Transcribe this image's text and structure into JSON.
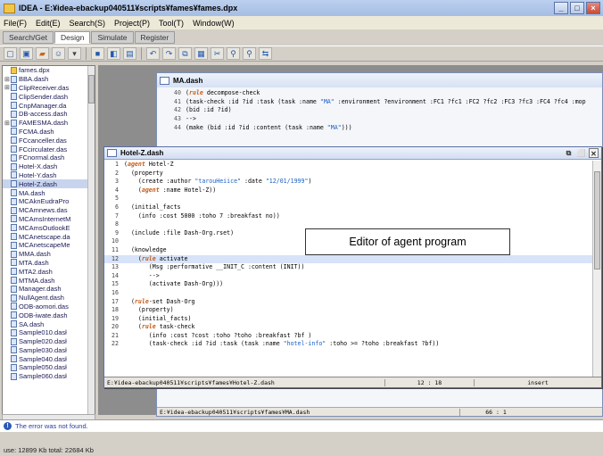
{
  "window": {
    "title": "IDEA - E:¥idea-ebackup040511¥scripts¥fames¥fames.dpx"
  },
  "menu": [
    "File(F)",
    "Edit(E)",
    "Search(S)",
    "Project(P)",
    "Tool(T)",
    "Window(W)"
  ],
  "tabs": [
    "Search/Get",
    "Design",
    "Simulate",
    "Register"
  ],
  "files": [
    {
      "name": "fames.dpx",
      "root": true
    },
    {
      "name": "BBA.dash",
      "plus": true
    },
    {
      "name": "ClipReceiver.das",
      "plus": true
    },
    {
      "name": "ClipSender.dash"
    },
    {
      "name": "CnpManager.da"
    },
    {
      "name": "DB-access.dash"
    },
    {
      "name": "FAMESMA.dash",
      "plus": true
    },
    {
      "name": "FCMA.dash"
    },
    {
      "name": "FCcanceller.das"
    },
    {
      "name": "FCcirculater.das"
    },
    {
      "name": "FCnormal.dash"
    },
    {
      "name": "Hotel-X.dash"
    },
    {
      "name": "Hotel-Y.dash"
    },
    {
      "name": "Hotel-Z.dash",
      "selected": true
    },
    {
      "name": "MA.dash"
    },
    {
      "name": "MCAknEudraPro"
    },
    {
      "name": "MCAmnews.das"
    },
    {
      "name": "MCAmsInternetM"
    },
    {
      "name": "MCAmsOutlookE"
    },
    {
      "name": "MCAnetscape.da"
    },
    {
      "name": "MCAnetscapeMe"
    },
    {
      "name": "MMA.dash"
    },
    {
      "name": "MTA.dash"
    },
    {
      "name": "MTA2.dash"
    },
    {
      "name": "MTMA.dash"
    },
    {
      "name": "Manager.dash"
    },
    {
      "name": "NullAgent.dash"
    },
    {
      "name": "ODB-aomori.das"
    },
    {
      "name": "ODB-iwate.dash"
    },
    {
      "name": "SA.dash"
    },
    {
      "name": "Sample010.dasł"
    },
    {
      "name": "Sample020.dasł"
    },
    {
      "name": "Sample030.dasł"
    },
    {
      "name": "Sample040.dasł"
    },
    {
      "name": "Sample050.dasł"
    },
    {
      "name": "Sample060.dasł"
    }
  ],
  "ma_window": {
    "title": "MA.dash",
    "lines": [
      {
        "n": "40",
        "text": "(rule decompose-check"
      },
      {
        "n": "41",
        "text": "    (task-check :id ?id :task (task :name \"MA\" :environment ?environment :FC1 ?fc1 :FC2 ?fc2 :FC3 ?fc3 :FC4 ?fc4 :mop"
      },
      {
        "n": "42",
        "text": "    (bid :id ?id)"
      },
      {
        "n": "43",
        "text": "    -->"
      },
      {
        "n": "44",
        "text": "    (make (bid :id ?id :content (task :name \"MA\")))"
      }
    ],
    "status_path": "E:¥idea-ebackup040511¥scripts¥fames¥MA.dash",
    "status_pos": "66 : 1"
  },
  "hotel_window": {
    "title": "Hotel-Z.dash",
    "lines": [
      {
        "n": "1",
        "text": "(agent Hotel-Z"
      },
      {
        "n": "2",
        "text": "  (property"
      },
      {
        "n": "3",
        "text": "    (create :author \"tarouHeiice\" :date \"12/01/1999\")"
      },
      {
        "n": "4",
        "text": "    (agent :name Hotel-Z))"
      },
      {
        "n": "5",
        "text": ""
      },
      {
        "n": "6",
        "text": "  (initial_facts"
      },
      {
        "n": "7",
        "text": "    (info :cost 5000 :toho 7 :breakfast no))"
      },
      {
        "n": "8",
        "text": ""
      },
      {
        "n": "9",
        "text": "  (include :file Dash-Org.rset)"
      },
      {
        "n": "10",
        "text": ""
      },
      {
        "n": "11",
        "text": "  (knowledge"
      },
      {
        "n": "12",
        "text": "    (rule activate"
      },
      {
        "n": "13",
        "text": "       (Msg :performative __INIT_C :content (INIT))"
      },
      {
        "n": "14",
        "text": "       -->"
      },
      {
        "n": "15",
        "text": "       (activate Dash-Org)))"
      },
      {
        "n": "16",
        "text": ""
      },
      {
        "n": "17",
        "text": "  (rule-set Dash-Org"
      },
      {
        "n": "18",
        "text": "    (property)"
      },
      {
        "n": "19",
        "text": "    (initial_facts)"
      },
      {
        "n": "20",
        "text": "    (rule task-check"
      },
      {
        "n": "21",
        "text": "       (info :cost ?cost :toho ?toho :breakfast ?bf )"
      },
      {
        "n": "22",
        "text": "       (task-check :id ?id :task (task :name \"hotel-info\" :toho >= ?toho :breakfast ?bf))"
      }
    ],
    "status_path": "E:¥idea-ebackup040511¥scripts¥fames¥Hotel-Z.dash",
    "status_pos": "12 : 18",
    "status_mode": "insert"
  },
  "annotation": "Editor of agent program",
  "message": "The error was not found.",
  "status": "use: 12899 Kb   total: 22684 Kb"
}
